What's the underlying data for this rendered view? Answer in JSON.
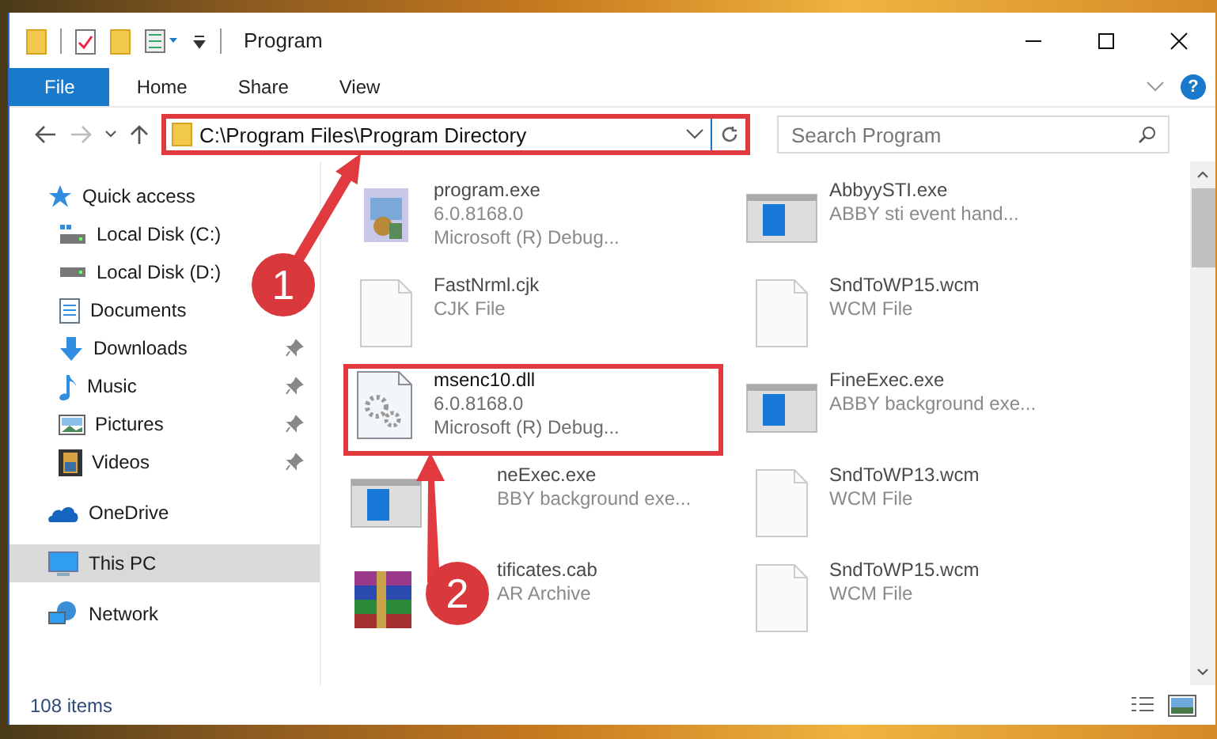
{
  "window": {
    "title": "Program"
  },
  "ribbon": {
    "tabs": [
      {
        "label": "File",
        "kind": "file"
      },
      {
        "label": "Home",
        "kind": "tab"
      },
      {
        "label": "Share",
        "kind": "tab"
      },
      {
        "label": "View",
        "kind": "tab"
      }
    ],
    "help": "?"
  },
  "address": {
    "path": "C:\\Program Files\\Program Directory",
    "highlighted": true
  },
  "search": {
    "placeholder": "Search Program"
  },
  "sidebar": {
    "items": [
      {
        "label": "Quick access",
        "kind": "quick",
        "selected": false,
        "children": [
          {
            "label": "Local Disk (C:)",
            "kind": "sysdrive",
            "selected": false,
            "pinned": false
          },
          {
            "label": "Local Disk (D:)",
            "kind": "drive",
            "selected": false,
            "pinned": false
          },
          {
            "label": "Documents",
            "kind": "documents",
            "selected": false,
            "pinned": false
          },
          {
            "label": "Downloads",
            "kind": "downloads",
            "selected": false,
            "pinned": true
          },
          {
            "label": "Music",
            "kind": "music",
            "selected": false,
            "pinned": true
          },
          {
            "label": "Pictures",
            "kind": "pictures",
            "selected": false,
            "pinned": true
          },
          {
            "label": "Videos",
            "kind": "videos",
            "selected": false,
            "pinned": true
          }
        ]
      },
      {
        "label": "OneDrive",
        "kind": "cloud",
        "selected": false
      },
      {
        "label": "This PC",
        "kind": "pc",
        "selected": true
      },
      {
        "label": "Network",
        "kind": "network",
        "selected": false
      }
    ]
  },
  "files": [
    {
      "name": "program.exe",
      "details": [
        "6.0.8168.0",
        "Microsoft (R) Debug..."
      ],
      "kind": "program",
      "blurred": true,
      "highlighted": false,
      "partly_hidden": false
    },
    {
      "name": "AbbyySTI.exe",
      "details": [
        "ABBY sti event hand..."
      ],
      "kind": "window",
      "blurred": true,
      "highlighted": false,
      "partly_hidden": false
    },
    {
      "name": "FastNrml.cjk",
      "details": [
        "CJK File"
      ],
      "kind": "blank",
      "blurred": true,
      "highlighted": false,
      "partly_hidden": false
    },
    {
      "name": "SndToWP15.wcm",
      "details": [
        "WCM File"
      ],
      "kind": "blank",
      "blurred": true,
      "highlighted": false,
      "partly_hidden": false
    },
    {
      "name": "msenc10.dll",
      "details": [
        "6.0.8168.0",
        "Microsoft (R) Debug..."
      ],
      "kind": "dll",
      "blurred": false,
      "highlighted": true,
      "partly_hidden": false
    },
    {
      "name": "FineExec.exe",
      "details": [
        "ABBY background exe..."
      ],
      "kind": "window",
      "blurred": true,
      "highlighted": false,
      "partly_hidden": false
    },
    {
      "name": "neExec.exe",
      "details": [
        "BBY background exe..."
      ],
      "kind": "window",
      "blurred": true,
      "highlighted": false,
      "partly_hidden": true
    },
    {
      "name": "SndToWP13.wcm",
      "details": [
        "WCM File"
      ],
      "kind": "blank",
      "blurred": true,
      "highlighted": false,
      "partly_hidden": false
    },
    {
      "name": "tificates.cab",
      "details": [
        "AR Archive"
      ],
      "kind": "archive",
      "blurred": true,
      "highlighted": false,
      "partly_hidden": true
    },
    {
      "name": "SndToWP15.wcm",
      "details": [
        "WCM File"
      ],
      "kind": "blank",
      "blurred": true,
      "highlighted": false,
      "partly_hidden": false
    }
  ],
  "callouts": [
    {
      "number": "1"
    },
    {
      "number": "2"
    }
  ],
  "status_bar": {
    "item_count": "108 items"
  }
}
